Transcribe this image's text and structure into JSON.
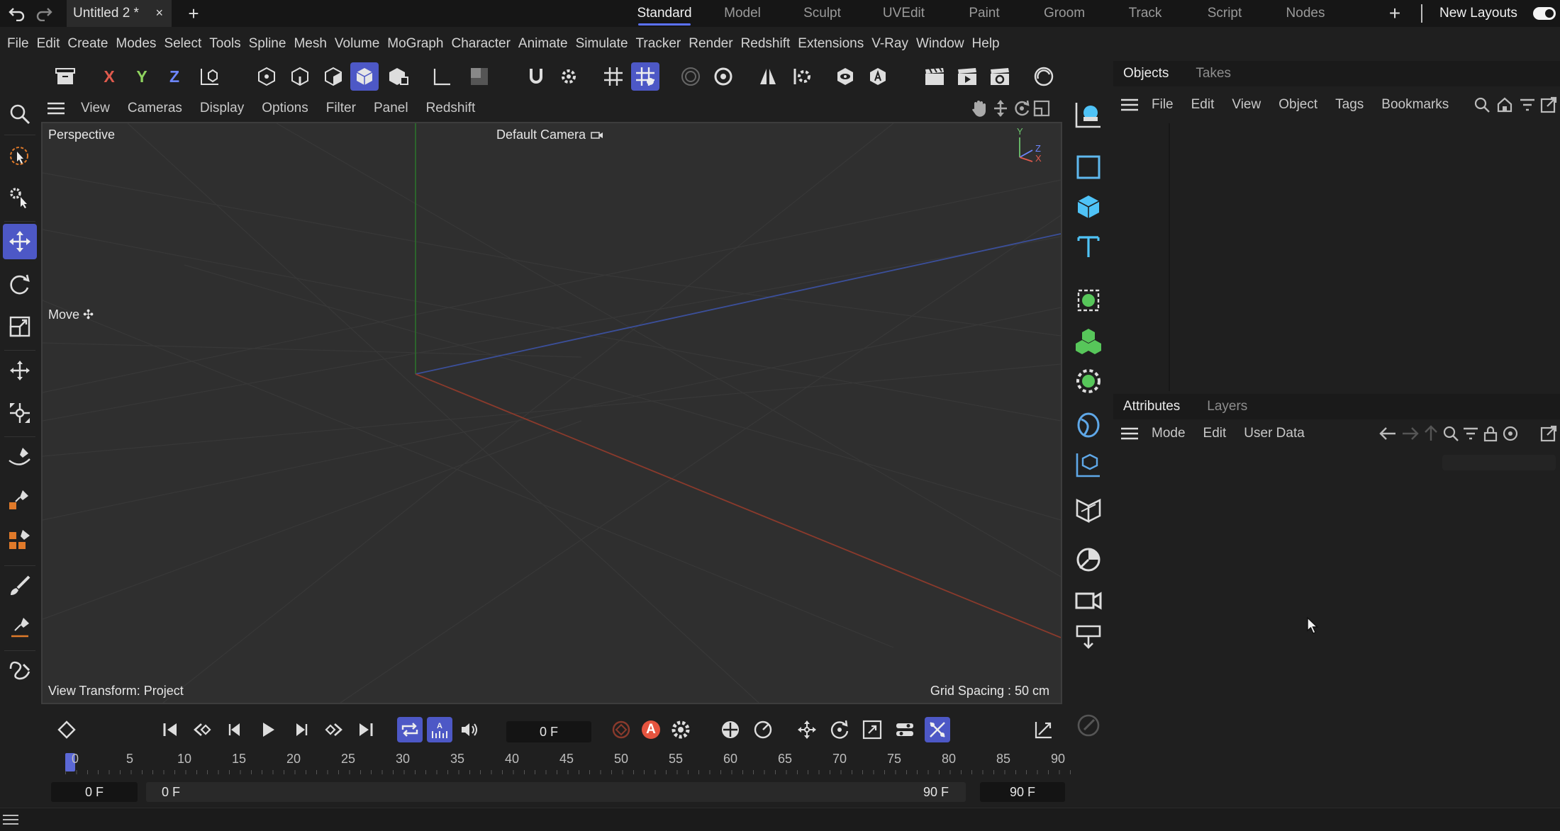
{
  "topbar": {
    "doc_tab": "Untitled 2 *",
    "close_icon": "×",
    "new_tab": "+",
    "layouts": [
      "Standard",
      "Model",
      "Sculpt",
      "UVEdit",
      "Paint",
      "Groom",
      "Track",
      "Script",
      "Nodes"
    ],
    "active_layout": "Standard",
    "add_layout": "+",
    "new_layouts": "New Layouts"
  },
  "menubar": [
    "File",
    "Edit",
    "Create",
    "Modes",
    "Select",
    "Tools",
    "Spline",
    "Mesh",
    "Volume",
    "MoGraph",
    "Character",
    "Animate",
    "Simulate",
    "Tracker",
    "Render",
    "Redshift",
    "Extensions",
    "V-Ray",
    "Window",
    "Help"
  ],
  "toolbar": {
    "axis_x": "X",
    "axis_y": "Y",
    "axis_z": "Z",
    "colors": {
      "x": "#e05a4d",
      "y": "#8fd35f",
      "z": "#6d86ff"
    }
  },
  "viewport": {
    "menu": [
      "View",
      "Cameras",
      "Display",
      "Options",
      "Filter",
      "Panel",
      "Redshift"
    ],
    "view_name": "Perspective",
    "camera": "Default Camera",
    "tool_label": "Move",
    "view_transform": "View Transform: Project",
    "grid_spacing": "Grid Spacing : 50 cm",
    "gizmo": {
      "y": "Y",
      "z": "Z",
      "x": "X"
    }
  },
  "objects_panel": {
    "tabs": [
      "Objects",
      "Takes"
    ],
    "active_tab": "Objects",
    "menu": [
      "File",
      "Edit",
      "View",
      "Object",
      "Tags",
      "Bookmarks"
    ]
  },
  "attributes_panel": {
    "tabs": [
      "Attributes",
      "Layers"
    ],
    "active_tab": "Attributes",
    "menu": [
      "Mode",
      "Edit",
      "User Data"
    ]
  },
  "timeline": {
    "current_frame": "0 F",
    "ticks": [
      "0",
      "5",
      "10",
      "15",
      "20",
      "25",
      "30",
      "35",
      "40",
      "45",
      "50",
      "55",
      "60",
      "65",
      "70",
      "75",
      "80",
      "85",
      "90"
    ],
    "start_field": "0 F",
    "preview_start": "0 F",
    "preview_end": "90 F",
    "end_field": "90 F",
    "record_label": "A"
  },
  "accent": "#4d58c6"
}
